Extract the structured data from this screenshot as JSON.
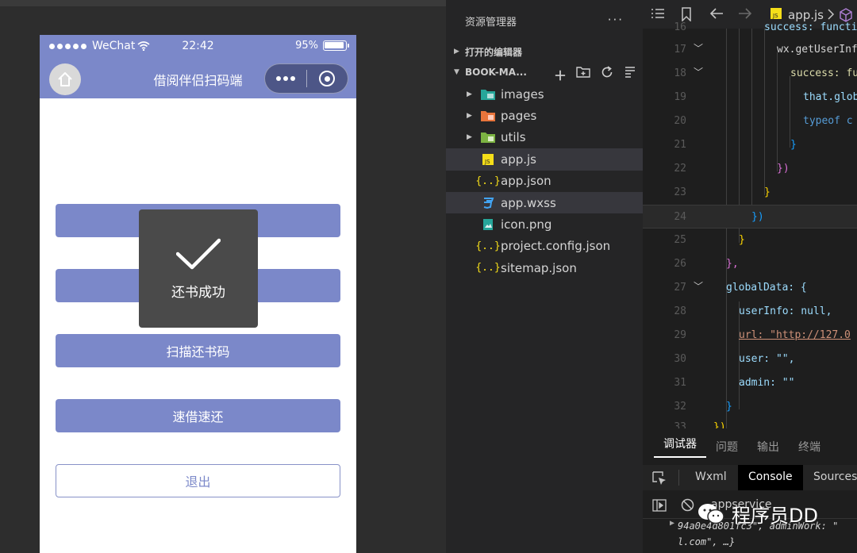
{
  "phone": {
    "carrier": "WeChat",
    "time": "22:42",
    "battery": "95%",
    "title": "借阅伴侣扫码端",
    "toast": "还书成功",
    "buttons": [
      "",
      "",
      "扫描还书码",
      "速借速还"
    ],
    "logout": "退出"
  },
  "explorer": {
    "title": "资源管理器",
    "more": "···",
    "open_editors": "打开的编辑器",
    "project": "BOOK-MA...",
    "files": [
      {
        "name": "images",
        "icon": "images-folder-icon",
        "color": "#4ec9b0"
      },
      {
        "name": "pages",
        "icon": "pages-folder-icon",
        "color": "#e8743b"
      },
      {
        "name": "utils",
        "icon": "utils-folder-icon",
        "color": "#8bc34a"
      },
      {
        "name": "app.js",
        "icon": "js-file-icon",
        "color": "#f5de19"
      },
      {
        "name": "app.json",
        "icon": "json-file-icon",
        "color": "#f5de19"
      },
      {
        "name": "app.wxss",
        "icon": "css-file-icon",
        "color": "#42a5f5"
      },
      {
        "name": "icon.png",
        "icon": "image-file-icon",
        "color": "#26a69a"
      },
      {
        "name": "project.config.json",
        "icon": "json-file-icon",
        "color": "#f5de19"
      },
      {
        "name": "sitemap.json",
        "icon": "json-file-icon",
        "color": "#f5de19"
      }
    ]
  },
  "editor": {
    "tab": "app.js",
    "lines": [
      {
        "n": "16",
        "t": "success: functi"
      },
      {
        "n": "17",
        "t": "wx.getUserInf"
      },
      {
        "n": "18",
        "t": "success: fu"
      },
      {
        "n": "19",
        "t": "that.glob"
      },
      {
        "n": "20",
        "t": "typeof c"
      },
      {
        "n": "21",
        "t": "}"
      },
      {
        "n": "22",
        "t": "})"
      },
      {
        "n": "23",
        "t": "}"
      },
      {
        "n": "24",
        "t": "})"
      },
      {
        "n": "25",
        "t": "}"
      },
      {
        "n": "26",
        "t": "},"
      },
      {
        "n": "27",
        "t": "globalData: {"
      },
      {
        "n": "28",
        "t": "userInfo: null,"
      },
      {
        "n": "29",
        "t": "url: \"http://127.0"
      },
      {
        "n": "30",
        "t": "user: \"\","
      },
      {
        "n": "31",
        "t": "admin: \"\""
      },
      {
        "n": "32",
        "t": "}"
      },
      {
        "n": "33",
        "t": "})"
      }
    ]
  },
  "devtools": {
    "tabs": [
      "调试器",
      "问题",
      "输出",
      "终端"
    ],
    "subtabs": [
      "Wxml",
      "Console",
      "Sources"
    ],
    "context": "appservice",
    "console_line1": "94a0e4d801fc3\", adminWork: \"",
    "console_line2": "l.com\", …}"
  },
  "watermark": "程序员DD"
}
